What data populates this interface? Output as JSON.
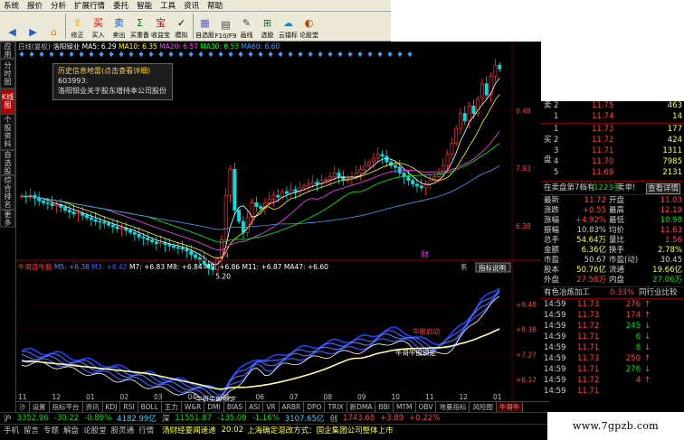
{
  "menu": [
    "系统",
    "报价",
    "分析",
    "扩展行情",
    "委托",
    "智能",
    "工具",
    "资讯",
    "帮助"
  ],
  "toolbar": [
    {
      "label": "",
      "icon": "back-icon",
      "glyph": "◀",
      "color": "#2060c0"
    },
    {
      "label": "",
      "icon": "forward-icon",
      "glyph": "▶",
      "color": "#2060c0"
    },
    {
      "label": "",
      "icon": "home-icon",
      "glyph": "⌂",
      "color": "#d08000"
    },
    {
      "label": "修正",
      "icon": "up-arrow-icon",
      "glyph": "⇧",
      "color": "#e0a000"
    },
    {
      "label": "买入",
      "icon": "buy-icon",
      "glyph": "买",
      "color": "#e00000"
    },
    {
      "label": "卖出",
      "icon": "sell-icon",
      "glyph": "卖",
      "color": "#0060e0"
    },
    {
      "label": "买重备",
      "icon": "reorder-icon",
      "glyph": "Σ",
      "color": "#008000"
    },
    {
      "label": "收益宝",
      "icon": "treasure-icon",
      "glyph": "宝",
      "color": "#e00000"
    },
    {
      "label": "模拟",
      "icon": "simulate-icon",
      "glyph": "✓",
      "color": "#000000"
    },
    {
      "label": "自选股",
      "icon": "watchlist-icon",
      "glyph": "▦",
      "color": "#6060c0"
    },
    {
      "label": "F10/F9",
      "icon": "f10-icon",
      "glyph": "▤",
      "color": "#404040"
    },
    {
      "label": "画线",
      "icon": "draw-line-icon",
      "glyph": "✎",
      "color": "#404040"
    },
    {
      "label": "选股",
      "icon": "stock-picker-icon",
      "glyph": "⊞",
      "color": "#306030"
    },
    {
      "label": "云镭标",
      "icon": "cloud-icon",
      "glyph": "☁",
      "color": "#2080d0"
    },
    {
      "label": "论股堂",
      "icon": "forum-icon",
      "glyph": "◐",
      "color": "#c04000"
    }
  ],
  "left_tabs": [
    {
      "label": "应用",
      "active": false
    },
    {
      "label": "分时图",
      "active": false
    },
    {
      "label": "K线图",
      "active": true
    },
    {
      "label": "个股资料",
      "active": false
    },
    {
      "label": "自选股",
      "active": false
    },
    {
      "label": "综合排名",
      "active": false
    },
    {
      "label": "更多",
      "active": false
    }
  ],
  "main_header": {
    "title": "日线(复权)",
    "stock": "洛阳钼业",
    "ma": [
      {
        "text": "MA5: 6.29",
        "color": "#ffffff"
      },
      {
        "text": "MA10: 6.35",
        "color": "#ffff00"
      },
      {
        "text": "MA20: 6.57",
        "color": "#ff40ff"
      },
      {
        "text": "MA30: 6.53",
        "color": "#00ff00"
      },
      {
        "text": "MA60: 6.60",
        "color": "#40a0ff"
      }
    ]
  },
  "tooltip": {
    "title": "历史信息地雷(点击查看详细)",
    "code": "603993:",
    "content": "洛阳钼业关于股东增持本公司股份"
  },
  "chart_data": [
    {
      "type": "candlestick",
      "title": "",
      "ylim": [
        5.6,
        10.8
      ],
      "y_ticks": [
        6.38,
        7.93,
        9.48
      ],
      "annotations": [
        {
          "text": "5.20",
          "series_pos": "low"
        },
        {
          "text": "q",
          "series_pos": "bottom"
        },
        {
          "text": "财",
          "series_pos": "bottom"
        }
      ],
      "price_series": [
        7.18,
        7.15,
        7.2,
        7.12,
        7.05,
        7.0,
        6.98,
        6.92,
        6.95,
        6.88,
        6.8,
        6.75,
        6.7,
        6.72,
        6.66,
        6.6,
        6.55,
        6.5,
        6.48,
        6.45,
        6.4,
        6.35,
        6.3,
        6.32,
        6.26,
        6.2,
        6.15,
        6.08,
        6.05,
        6.0,
        5.95,
        5.9,
        5.92,
        5.88,
        5.84,
        5.8,
        5.78,
        5.75,
        5.7,
        5.6,
        5.52,
        5.45,
        5.35,
        5.25,
        5.2,
        5.5,
        6.0,
        7.2,
        7.9,
        6.8,
        6.5,
        6.2,
        6.6,
        7.0,
        6.9,
        6.85,
        7.0,
        7.1,
        7.2,
        7.15,
        7.3,
        7.25,
        7.35,
        7.3,
        7.4,
        7.45,
        7.5,
        7.55,
        7.5,
        7.6,
        7.62,
        7.7,
        7.8,
        7.7,
        7.6,
        7.65,
        7.7,
        7.8,
        7.9,
        8.0,
        8.1,
        8.2,
        8.3,
        8.25,
        8.1,
        8.0,
        7.95,
        7.8,
        7.7,
        7.6,
        7.5,
        7.45,
        7.4,
        7.5,
        7.6,
        7.7,
        7.8,
        8.0,
        8.3,
        8.6,
        9.0,
        9.4,
        9.2,
        9.6,
        9.4,
        9.8,
        10.2,
        9.9,
        10.4,
        10.7,
        10.6
      ]
    },
    {
      "type": "line",
      "title": "牛哥选牛股",
      "ylim": [
        5.6,
        10.8
      ],
      "y_ticks": [
        6.17,
        7.27,
        8.38,
        9.48
      ],
      "legend": [
        {
          "text": "M5: +6.36",
          "color": "#6080ff"
        },
        {
          "text": "M3: +6.42",
          "color": "#4060ff"
        },
        {
          "text": "M7: +6.83",
          "color": "#ffffff"
        },
        {
          "text": "M8: +6.84",
          "color": "#ffffff"
        },
        {
          "text": "M9: +6.86",
          "color": "#ffffff"
        },
        {
          "text": "M11: +6.87",
          "color": "#ffffff"
        },
        {
          "text": "MA47: +6.60",
          "color": "#ffffff"
        }
      ],
      "annotations": [
        "牛哥牛股锁定",
        "牛股启动",
        "牛哥牛股锁定"
      ],
      "x_labels": [
        "11",
        "12",
        "01",
        "02",
        "03",
        "04",
        "05",
        "06",
        "07",
        "08",
        "09",
        "10",
        "11",
        "12",
        "01"
      ],
      "buttons": [
        "系",
        "指标说明"
      ]
    }
  ],
  "bottom_tabs": [
    "沙",
    "设置",
    "指标平台",
    "资讯",
    "KDJ",
    "RSI",
    "BOLL",
    "王力",
    "W&R",
    "DMI",
    "BIAS",
    "ASI",
    "VR",
    "ARBR",
    "DPO",
    "TRIX",
    "新DMA",
    "BBI",
    "MTM",
    "OBV",
    "地量指标",
    "风险图",
    "牛哥牛"
  ],
  "bottom_tabs_active": "牛哥牛",
  "status1": [
    {
      "text": "沪",
      "color": "#c0c0c0"
    },
    {
      "text": "3352.96",
      "color": "#00e000"
    },
    {
      "text": "-30.22",
      "color": "#00e000"
    },
    {
      "text": "-0.89%",
      "color": "#00e000"
    },
    {
      "text": "4182.99亿",
      "color": "#40d0ff"
    },
    {
      "text": "深",
      "color": "#c0c0c0"
    },
    {
      "text": "11551.87",
      "color": "#00e000"
    },
    {
      "text": "-135.09",
      "color": "#00e000"
    },
    {
      "text": "-1.16%",
      "color": "#00e000"
    },
    {
      "text": "3107.65亿",
      "color": "#40d0ff"
    },
    {
      "text": "创",
      "color": "#c0c0c0"
    },
    {
      "text": "1743.68",
      "color": "#ff4040"
    },
    {
      "text": "+3.89",
      "color": "#ff4040"
    },
    {
      "text": "+0.22%",
      "color": "#ff4040"
    }
  ],
  "status2": {
    "items": [
      "手机",
      "留言",
      "专题",
      "解盘",
      "论股堂",
      "股灵通",
      "行情"
    ],
    "news_label": "汤财经要闻速递",
    "time": "20:02",
    "headline": "上海确定混改方式：国企集团公司整体上市"
  },
  "watermark": "www.7gpzb.com",
  "right_panel": {
    "sell_label": "卖",
    "buy_label": "买",
    "buy_label2": "盘",
    "sell_rows": [
      {
        "idx": "2",
        "price": "11.75",
        "vol": "463"
      },
      {
        "idx": "1",
        "price": "11.74",
        "vol": "14"
      }
    ],
    "buy_rows": [
      {
        "idx": "1",
        "price": "11.73",
        "vol": "177"
      },
      {
        "idx": "2",
        "price": "11.72",
        "vol": "424"
      },
      {
        "idx": "3",
        "price": "11.71",
        "vol": "1311"
      },
      {
        "idx": "4",
        "price": "11.70",
        "vol": "7985"
      },
      {
        "idx": "5",
        "price": "11.69",
        "vol": "2131"
      }
    ],
    "info_bar": {
      "text1": "在卖盘第7档有",
      "text2": "1223手",
      "text3": "卖单!",
      "btn": "查看详情"
    },
    "stats": [
      {
        "l1": "最新",
        "v1": "11.72",
        "c1": "r",
        "l2": "开盘",
        "v2": "11.03",
        "c2": "r"
      },
      {
        "l1": "涨跌",
        "v1": "+0.55",
        "c1": "r",
        "l2": "最高",
        "v2": "12.19",
        "c2": "r"
      },
      {
        "l1": "涨幅",
        "v1": "+4.92%",
        "c1": "r",
        "l2": "最低",
        "v2": "10.98",
        "c2": "g"
      },
      {
        "l1": "振幅",
        "v1": "10.83%",
        "c1": "w",
        "l2": "均价",
        "v2": "11.63",
        "c2": "r"
      },
      {
        "l1": "总手",
        "v1": "54.64万",
        "c1": "y",
        "l2": "量比",
        "v2": "1.56",
        "c2": "r"
      },
      {
        "l1": "金额",
        "v1": "6.36亿",
        "c1": "y",
        "l2": "换手",
        "v2": "2.78%",
        "c2": "y"
      },
      {
        "l1": "市盈",
        "v1": "50.67",
        "c1": "w",
        "l2": "市盈(动)",
        "v2": "30.45",
        "c2": "w"
      },
      {
        "l1": "股本",
        "v1": "50.76亿",
        "c1": "y",
        "l2": "流通",
        "v2": "19.66亿",
        "c2": "y"
      },
      {
        "l1": "外盘",
        "v1": "27.58万",
        "c1": "r",
        "l2": "内盘",
        "v2": "27.06万",
        "c2": "g"
      }
    ],
    "sector": {
      "name": "有色冶炼加工",
      "pct": "0.33%",
      "link": "同行业比较"
    },
    "ticks": [
      {
        "t": "14:59",
        "p": "11.73",
        "v": "276",
        "d": "up"
      },
      {
        "t": "14:59",
        "p": "11.73",
        "v": "174",
        "d": "up"
      },
      {
        "t": "14:59",
        "p": "11.72",
        "v": "245",
        "d": "down"
      },
      {
        "t": "14:59",
        "p": "11.71",
        "v": "6",
        "d": "down"
      },
      {
        "t": "14:59",
        "p": "11.71",
        "v": "8",
        "d": "down"
      },
      {
        "t": "14:59",
        "p": "11.73",
        "v": "250",
        "d": "up"
      },
      {
        "t": "14:59",
        "p": "11.71",
        "v": "276",
        "d": "down"
      },
      {
        "t": "14:59",
        "p": "11.72",
        "v": "4",
        "d": "up"
      },
      {
        "t": "14:59",
        "p": "11.71",
        "v": "",
        "d": ""
      }
    ]
  }
}
